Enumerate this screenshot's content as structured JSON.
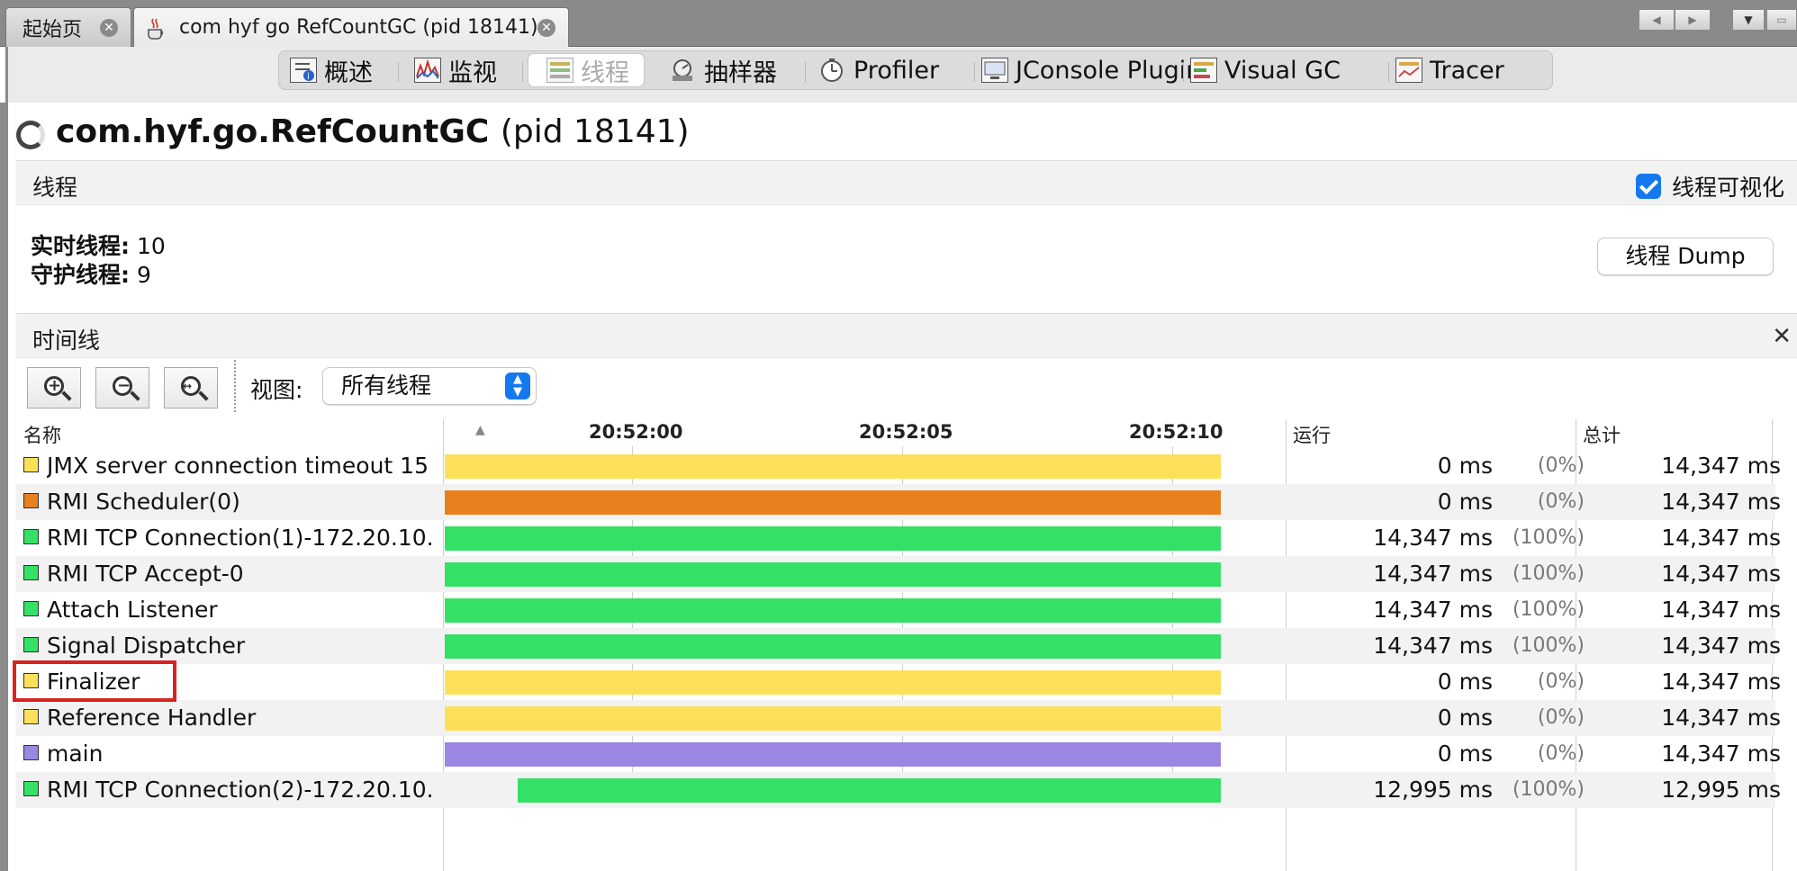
{
  "doc_tabs": [
    {
      "label": "起始页",
      "active": false
    },
    {
      "label": "com hyf go RefCountGC (pid 18141)",
      "active": true
    }
  ],
  "sub_tabs": [
    {
      "label": "概述",
      "icon": "overview-icon",
      "active": false
    },
    {
      "label": "监视",
      "icon": "monitor-icon",
      "active": false
    },
    {
      "label": "线程",
      "icon": "threads-icon",
      "active": true
    },
    {
      "label": "抽样器",
      "icon": "sampler-icon",
      "active": false
    },
    {
      "label": "Profiler",
      "icon": "profiler-icon",
      "active": false
    },
    {
      "label": "JConsole Plugins",
      "icon": "jconsole-icon",
      "active": false
    },
    {
      "label": "Visual GC",
      "icon": "visual-gc-icon",
      "active": false
    },
    {
      "label": "Tracer",
      "icon": "tracer-icon",
      "active": false
    }
  ],
  "page": {
    "title_main": "com.hyf.go.RefCountGC",
    "title_pid": "(pid 18141)"
  },
  "threads_section": {
    "label": "线程",
    "visualize_label": "线程可视化",
    "visualize_checked": true,
    "live_label": "实时线程:",
    "live_value": "10",
    "daemon_label": "守护线程:",
    "daemon_value": "9",
    "dump_button": "线程 Dump"
  },
  "timeline_section": {
    "label": "时间线",
    "view_label": "视图:",
    "view_value": "所有线程"
  },
  "table": {
    "columns": {
      "name": "名称",
      "running": "运行",
      "total": "总计"
    },
    "time_ticks": [
      "20:52:00",
      "20:52:05",
      "20:52:10"
    ],
    "rows": [
      {
        "name": "JMX server connection timeout 15",
        "color": "#fde05a",
        "start": 0.0,
        "run": "0 ms",
        "pct": "(0%)",
        "total": "14,347 ms"
      },
      {
        "name": "RMI Scheduler(0)",
        "color": "#e88020",
        "start": 0.0,
        "run": "0 ms",
        "pct": "(0%)",
        "total": "14,347 ms"
      },
      {
        "name": "RMI TCP Connection(1)-172.20.10.",
        "color": "#35e066",
        "start": 0.0,
        "run": "14,347 ms",
        "pct": "(100%)",
        "total": "14,347 ms"
      },
      {
        "name": "RMI TCP Accept-0",
        "color": "#35e066",
        "start": 0.0,
        "run": "14,347 ms",
        "pct": "(100%)",
        "total": "14,347 ms"
      },
      {
        "name": "Attach Listener",
        "color": "#35e066",
        "start": 0.0,
        "run": "14,347 ms",
        "pct": "(100%)",
        "total": "14,347 ms"
      },
      {
        "name": "Signal Dispatcher",
        "color": "#35e066",
        "start": 0.0,
        "run": "14,347 ms",
        "pct": "(100%)",
        "total": "14,347 ms"
      },
      {
        "name": "Finalizer",
        "color": "#fde05a",
        "start": 0.0,
        "run": "0 ms",
        "pct": "(0%)",
        "total": "14,347 ms",
        "highlighted": true
      },
      {
        "name": "Reference Handler",
        "color": "#fde05a",
        "start": 0.0,
        "run": "0 ms",
        "pct": "(0%)",
        "total": "14,347 ms"
      },
      {
        "name": "main",
        "color": "#9b86e2",
        "start": 0.0,
        "run": "0 ms",
        "pct": "(0%)",
        "total": "14,347 ms"
      },
      {
        "name": "RMI TCP Connection(2)-172.20.10.",
        "color": "#35e066",
        "start": 0.094,
        "run": "12,995 ms",
        "pct": "(100%)",
        "total": "12,995 ms"
      }
    ]
  }
}
